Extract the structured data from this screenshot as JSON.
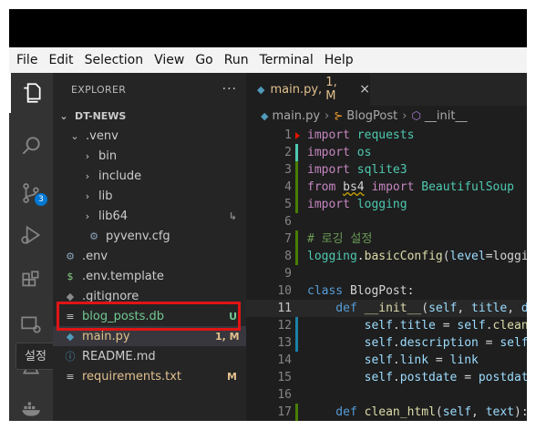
{
  "menubar": [
    "File",
    "Edit",
    "Selection",
    "View",
    "Go",
    "Run",
    "Terminal",
    "Help"
  ],
  "activity_bar": {
    "source_control_badge": "3",
    "tooltip": "설정"
  },
  "explorer": {
    "title": "EXPLORER",
    "more": "···",
    "root": "DT-NEWS",
    "items": [
      {
        "label": ".venv",
        "chevron": "⌄",
        "icon": "",
        "color": "#cccccc",
        "status": "",
        "status_color": ""
      },
      {
        "label": "bin",
        "chevron": "›",
        "icon": "",
        "color": "#cccccc",
        "status": "",
        "status_color": ""
      },
      {
        "label": "include",
        "chevron": "›",
        "icon": "",
        "color": "#cccccc",
        "status": "",
        "status_color": ""
      },
      {
        "label": "lib",
        "chevron": "›",
        "icon": "",
        "color": "#cccccc",
        "status": "",
        "status_color": ""
      },
      {
        "label": "lib64",
        "chevron": "›",
        "icon": "",
        "color": "#cccccc",
        "status": "↳",
        "status_color": "#8a8a8a"
      },
      {
        "label": "pyvenv.cfg",
        "chevron": "",
        "icon": "⚙",
        "color": "#cccccc",
        "status": "",
        "status_color": ""
      },
      {
        "label": ".env",
        "chevron": "",
        "icon": "⚙",
        "color": "#cccccc",
        "status": "",
        "status_color": ""
      },
      {
        "label": ".env.template",
        "chevron": "",
        "icon": "$",
        "color": "#cccccc",
        "status": "",
        "status_color": ""
      },
      {
        "label": ".gitignore",
        "chevron": "",
        "icon": "◆",
        "color": "#cccccc",
        "status": "",
        "status_color": ""
      },
      {
        "label": "blog_posts.db",
        "chevron": "",
        "icon": "≡",
        "color": "#73c991",
        "status": "U",
        "status_color": "#73c991"
      },
      {
        "label": "main.py",
        "chevron": "",
        "icon": "◆",
        "color": "#e2c08d",
        "status": "1, M",
        "status_color": "#e2c08d"
      },
      {
        "label": "README.md",
        "chevron": "",
        "icon": "ⓘ",
        "color": "#cccccc",
        "status": "",
        "status_color": ""
      },
      {
        "label": "requirements.txt",
        "chevron": "",
        "icon": "≡",
        "color": "#e2c08d",
        "status": "M",
        "status_color": "#e2c08d"
      }
    ]
  },
  "tab": {
    "filename": "main.py",
    "marks": "1, M",
    "close": "×"
  },
  "breadcrumb": {
    "file": "main.py",
    "class_name": "BlogPost",
    "method": "__init__"
  },
  "code": {
    "line_numbers": [
      "1",
      "2",
      "3",
      "4",
      "5",
      "6",
      "7",
      "8",
      "9",
      "10",
      "11",
      "12",
      "13",
      "14",
      "15",
      "16",
      "17"
    ],
    "current_line": 11,
    "lines": [
      [
        [
          "import ",
          "ctl"
        ],
        [
          "requests",
          "cls"
        ]
      ],
      [
        [
          "import ",
          "ctl"
        ],
        [
          "os",
          "cls"
        ]
      ],
      [
        [
          "import ",
          "ctl"
        ],
        [
          "sqlite3",
          "cls"
        ]
      ],
      [
        [
          "from ",
          "ctl"
        ],
        [
          "bs4",
          "sq"
        ],
        [
          " import ",
          "ctl"
        ],
        [
          "BeautifulSoup",
          "cls"
        ]
      ],
      [
        [
          "import ",
          "ctl"
        ],
        [
          "logging",
          "cls"
        ]
      ],
      [],
      [
        [
          "# 로깅 설정",
          "cmt"
        ]
      ],
      [
        [
          "logging",
          "cls"
        ],
        [
          ".",
          ""
        ],
        [
          "basicConfig",
          "fn"
        ],
        [
          "(",
          ""
        ],
        [
          "level",
          "prm"
        ],
        [
          "=logging.",
          ""
        ]
      ],
      [],
      [
        [
          "class ",
          "kw"
        ],
        [
          "BlogPost",
          ""
        ],
        [
          ":",
          ""
        ]
      ],
      [
        [
          "    def ",
          "kw"
        ],
        [
          "__init__",
          "fn"
        ],
        [
          "(",
          ""
        ],
        [
          "self",
          "prm"
        ],
        [
          ", ",
          ""
        ],
        [
          "title",
          "prm"
        ],
        [
          ", ",
          ""
        ],
        [
          "desc",
          "prm"
        ]
      ],
      [
        [
          "        self",
          "prm"
        ],
        [
          ".",
          ""
        ],
        [
          "title",
          "prm"
        ],
        [
          " = ",
          ""
        ],
        [
          "self",
          "prm"
        ],
        [
          ".",
          ""
        ],
        [
          "clean_htm",
          "fn"
        ]
      ],
      [
        [
          "        self",
          "prm"
        ],
        [
          ".",
          ""
        ],
        [
          "description",
          "prm"
        ],
        [
          " = ",
          ""
        ],
        [
          "self",
          "prm"
        ],
        [
          ".cl",
          ""
        ]
      ],
      [
        [
          "        self",
          "prm"
        ],
        [
          ".",
          ""
        ],
        [
          "link",
          "prm"
        ],
        [
          " = ",
          ""
        ],
        [
          "link",
          "prm"
        ]
      ],
      [
        [
          "        self",
          "prm"
        ],
        [
          ".",
          ""
        ],
        [
          "postdate",
          "prm"
        ],
        [
          " = ",
          ""
        ],
        [
          "postdate",
          "prm"
        ]
      ],
      [],
      [
        [
          "    def ",
          "kw"
        ],
        [
          "clean_html",
          "fn"
        ],
        [
          "(",
          ""
        ],
        [
          "self",
          "prm"
        ],
        [
          ", ",
          ""
        ],
        [
          "text",
          "prm"
        ],
        [
          "):",
          ""
        ]
      ]
    ]
  }
}
